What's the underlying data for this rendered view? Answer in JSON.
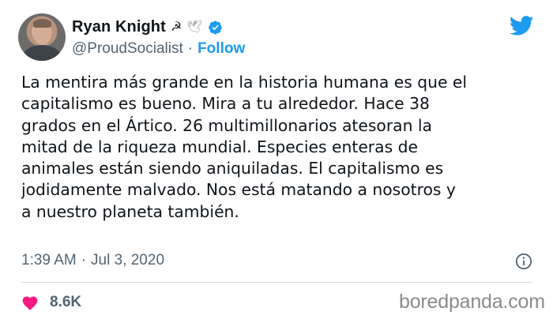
{
  "user": {
    "display_name": "Ryan Knight",
    "name_emojis": [
      "☭",
      "🕊"
    ],
    "handle": "@ProudSocialist",
    "separator": "·",
    "follow_label": "Follow",
    "verified": true
  },
  "tweet": {
    "text": "La mentira más grande en la historia humana es que el\ncapitalismo es bueno. Mira a tu alrededor. Hace 38\ngrados en el Ártico. 26 multimillonarios atesoran la\nmitad de la riqueza mundial. Especies enteras de\nanimales están siendo aniquiladas. El capitalismo es\njodidamente malvado. Nos está matando a nosotros y\na nuestro planeta también.",
    "time": "1:39 AM",
    "separator": "·",
    "date": "Jul 3, 2020",
    "likes": "8.6K"
  },
  "watermark": "boredpanda.com",
  "colors": {
    "accent": "#1d9bf0",
    "heart": "#f91880",
    "muted": "#536471",
    "text": "#0f1419"
  },
  "icons": {
    "logo": "twitter-bird-icon",
    "verified": "verified-badge-icon",
    "info": "info-icon",
    "like": "heart-icon"
  }
}
